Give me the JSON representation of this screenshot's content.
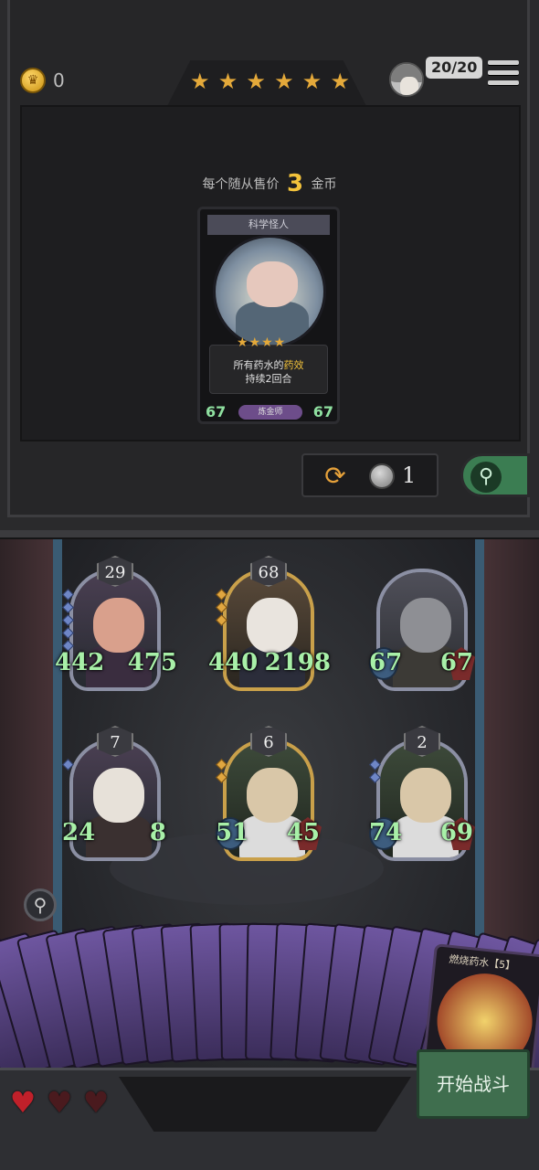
{
  "header": {
    "coins": "0",
    "stars": [
      "★",
      "★",
      "★",
      "★",
      "★",
      "★"
    ],
    "capacity": "20/20"
  },
  "shop": {
    "sell_prefix": "每个随从售价",
    "sell_price": "3",
    "sell_suffix": "金币",
    "card": {
      "name": "科学怪人",
      "stars": "★★★★",
      "desc_prefix": "所有药水的",
      "desc_highlight": "药效",
      "desc_line2": "持续2回合",
      "attack": "67",
      "health": "67",
      "tribe": "炼金师"
    },
    "refresh_cost": "1"
  },
  "board": {
    "minions": [
      {
        "level": "29",
        "attack": "442",
        "health": "475"
      },
      {
        "level": "68",
        "attack": "440",
        "health": "2198"
      },
      {
        "level": "",
        "attack": "67",
        "health": "67"
      },
      {
        "level": "7",
        "attack": "24",
        "health": "8"
      },
      {
        "level": "6",
        "attack": "51",
        "health": "45"
      },
      {
        "level": "2",
        "attack": "74",
        "health": "69"
      }
    ]
  },
  "hand": {
    "potion_label": "燃烧药水【5】"
  },
  "footer": {
    "start_label": "开始战斗",
    "hearts": [
      "♥",
      "♥",
      "♥"
    ]
  }
}
